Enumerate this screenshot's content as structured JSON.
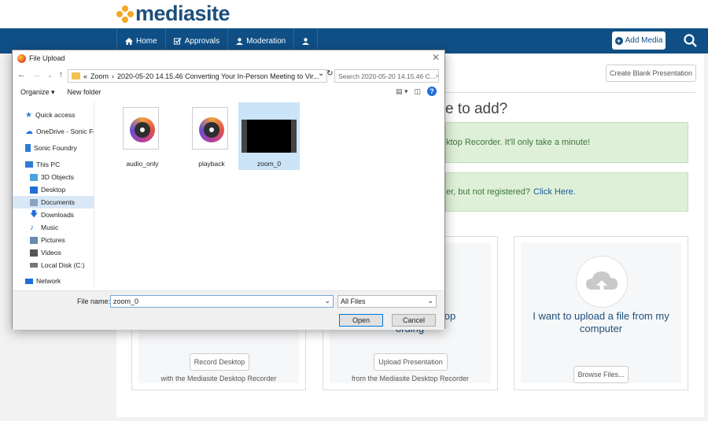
{
  "app": {
    "logo": "mediasite"
  },
  "nav": {
    "home": "Home",
    "approvals": "Approvals",
    "moderation": "Moderation"
  },
  "header": {
    "add_media": "Add Media"
  },
  "main": {
    "create_blank": "Create Blank Presentation",
    "question": "e to add?",
    "alert1": "ktop Recorder. It'll only take a minute!",
    "alert2_text": "er, but not registered?",
    "alert2_link": "Click Here.",
    "cards": [
      {
        "title": "",
        "button": "Record Desktop",
        "sub": "with the Mediasite Desktop Recorder"
      },
      {
        "title": "g desktop",
        "title2": "ording",
        "button": "Upload Presentation",
        "sub": "from the Mediasite Desktop Recorder"
      },
      {
        "title": "I want to upload a file from my",
        "title2": "computer",
        "button": "Browse Files...",
        "sub": ""
      }
    ]
  },
  "dialog": {
    "title": "File Upload",
    "path_prefix": "«",
    "path_root": "Zoom",
    "path_sep": "›",
    "path_folder": "2020-05-20 14.15.46 Converting Your In-Person Meeting to Vir...",
    "search_placeholder": "Search 2020-05-20 14.15.46 C...",
    "organize": "Organize ▾",
    "new_folder": "New folder",
    "nav_items": [
      {
        "label": "Quick access",
        "icon": "star-icon",
        "color": "#2f7bd5"
      },
      {
        "label": "OneDrive - Sonic Fou",
        "icon": "cloud-icon",
        "color": "#1e6fd9"
      },
      {
        "label": "Sonic Foundry",
        "icon": "building-icon",
        "color": "#2f7bd5"
      },
      {
        "label": "This PC",
        "icon": "computer-icon",
        "color": "#2f7bd5"
      },
      {
        "label": "3D Objects",
        "icon": "cube-icon",
        "color": "#4aa3df"
      },
      {
        "label": "Desktop",
        "icon": "desktop-folder-icon",
        "color": "#1e6fd9"
      },
      {
        "label": "Documents",
        "icon": "documents-icon",
        "color": "#8aa4c0"
      },
      {
        "label": "Downloads",
        "icon": "download-icon",
        "color": "#1e6fd9"
      },
      {
        "label": "Music",
        "icon": "music-icon",
        "color": "#1e6fd9"
      },
      {
        "label": "Pictures",
        "icon": "pictures-icon",
        "color": "#6b8aa8"
      },
      {
        "label": "Videos",
        "icon": "videos-icon",
        "color": "#555555"
      },
      {
        "label": "Local Disk (C:)",
        "icon": "disk-icon",
        "color": "#777777"
      },
      {
        "label": "Network",
        "icon": "network-icon",
        "color": "#1e6fd9"
      }
    ],
    "files": [
      {
        "name": "audio_only",
        "type": "audio"
      },
      {
        "name": "playback",
        "type": "audio"
      },
      {
        "name": "zoom_0",
        "type": "video"
      }
    ],
    "file_name_label": "File name:",
    "file_name_value": "zoom_0",
    "filter_value": "All Files",
    "open_label": "Open",
    "cancel_label": "Cancel"
  },
  "colors": {
    "nav_bg": "#0f4f86",
    "accent": "#1d4f7c",
    "logo_dots": "#f5a623",
    "alert_bg": "#dff0d8"
  }
}
